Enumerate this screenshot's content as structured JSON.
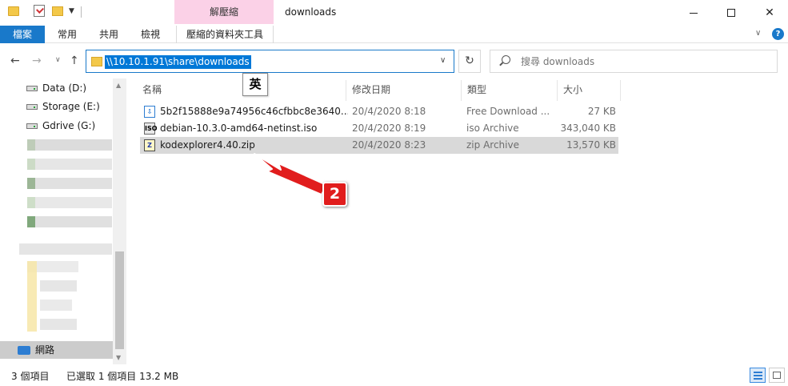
{
  "window": {
    "title": "downloads",
    "context_tab_header": "解壓縮",
    "minimize": "—",
    "close": "✕"
  },
  "ribbon": {
    "tabs": [
      {
        "label": "檔案"
      },
      {
        "label": "常用"
      },
      {
        "label": "共用"
      },
      {
        "label": "檢視"
      },
      {
        "label": "壓縮的資料夾工具"
      }
    ],
    "expand_glyph": "∨",
    "help_glyph": "?"
  },
  "nav": {
    "back_glyph": "←",
    "forward_glyph": "→",
    "recent_glyph": "∨",
    "up_glyph": "↑",
    "address": "\\\\10.10.1.91\\share\\downloads",
    "address_drop_glyph": "∨",
    "refresh_glyph": "↻",
    "search_placeholder": "搜尋 downloads",
    "ime_indicator": "英"
  },
  "navpane": {
    "drives": [
      {
        "label": "Data (D:)"
      },
      {
        "label": "Storage (E:)"
      },
      {
        "label": "Gdrive (G:)"
      }
    ],
    "network": "網路"
  },
  "filelist": {
    "columns": [
      "名稱",
      "修改日期",
      "類型",
      "大小"
    ],
    "rows": [
      {
        "name": "5b2f15888e9a74956c46cfbbc8e3640...",
        "date": "20/4/2020 8:18",
        "type": "Free Download ...",
        "size": "27 KB",
        "icon": "download-file-icon",
        "selected": false
      },
      {
        "name": "debian-10.3.0-amd64-netinst.iso",
        "date": "20/4/2020 8:19",
        "type": "iso Archive",
        "size": "343,040 KB",
        "icon": "iso-file-icon",
        "selected": false
      },
      {
        "name": "kodexplorer4.40.zip",
        "date": "20/4/2020 8:23",
        "type": "zip Archive",
        "size": "13,570 KB",
        "icon": "zip-file-icon",
        "selected": true
      }
    ]
  },
  "annotation": {
    "badge": "2",
    "color": "#e11d1d"
  },
  "status": {
    "count": "3 個項目",
    "selection": "已選取 1 個項目  13.2 MB"
  },
  "colors": {
    "accent": "#1979ca",
    "context_tab": "#fbd1e7",
    "selection": "#d9d9d9",
    "address_highlight": "#0078d7"
  }
}
